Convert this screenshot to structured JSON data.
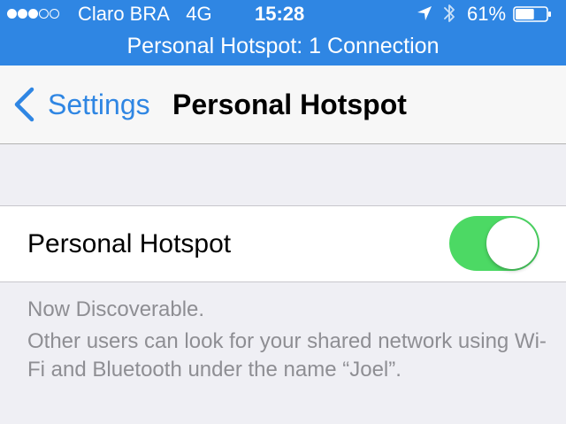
{
  "status_bar": {
    "signal": {
      "filled": 3,
      "total": 5
    },
    "carrier": "Claro BRA",
    "network": "4G",
    "time": "15:28",
    "battery_percent_label": "61%",
    "battery_level": 0.61,
    "icons": [
      "location-arrow-icon",
      "bluetooth-icon",
      "battery-icon"
    ]
  },
  "hotspot_banner": "Personal Hotspot: 1 Connection",
  "nav": {
    "back_label": "Settings",
    "title": "Personal Hotspot"
  },
  "hotspot_cell": {
    "label": "Personal Hotspot",
    "toggle_on": true
  },
  "footer": {
    "status": "Now Discoverable.",
    "description": "Other users can look for your shared network using Wi-Fi and Bluetooth under the name “Joel”."
  },
  "colors": {
    "accent": "#2f86e3",
    "toggle_on": "#4cd964",
    "background": "#efeff4",
    "footer_text": "#8e8e93"
  }
}
